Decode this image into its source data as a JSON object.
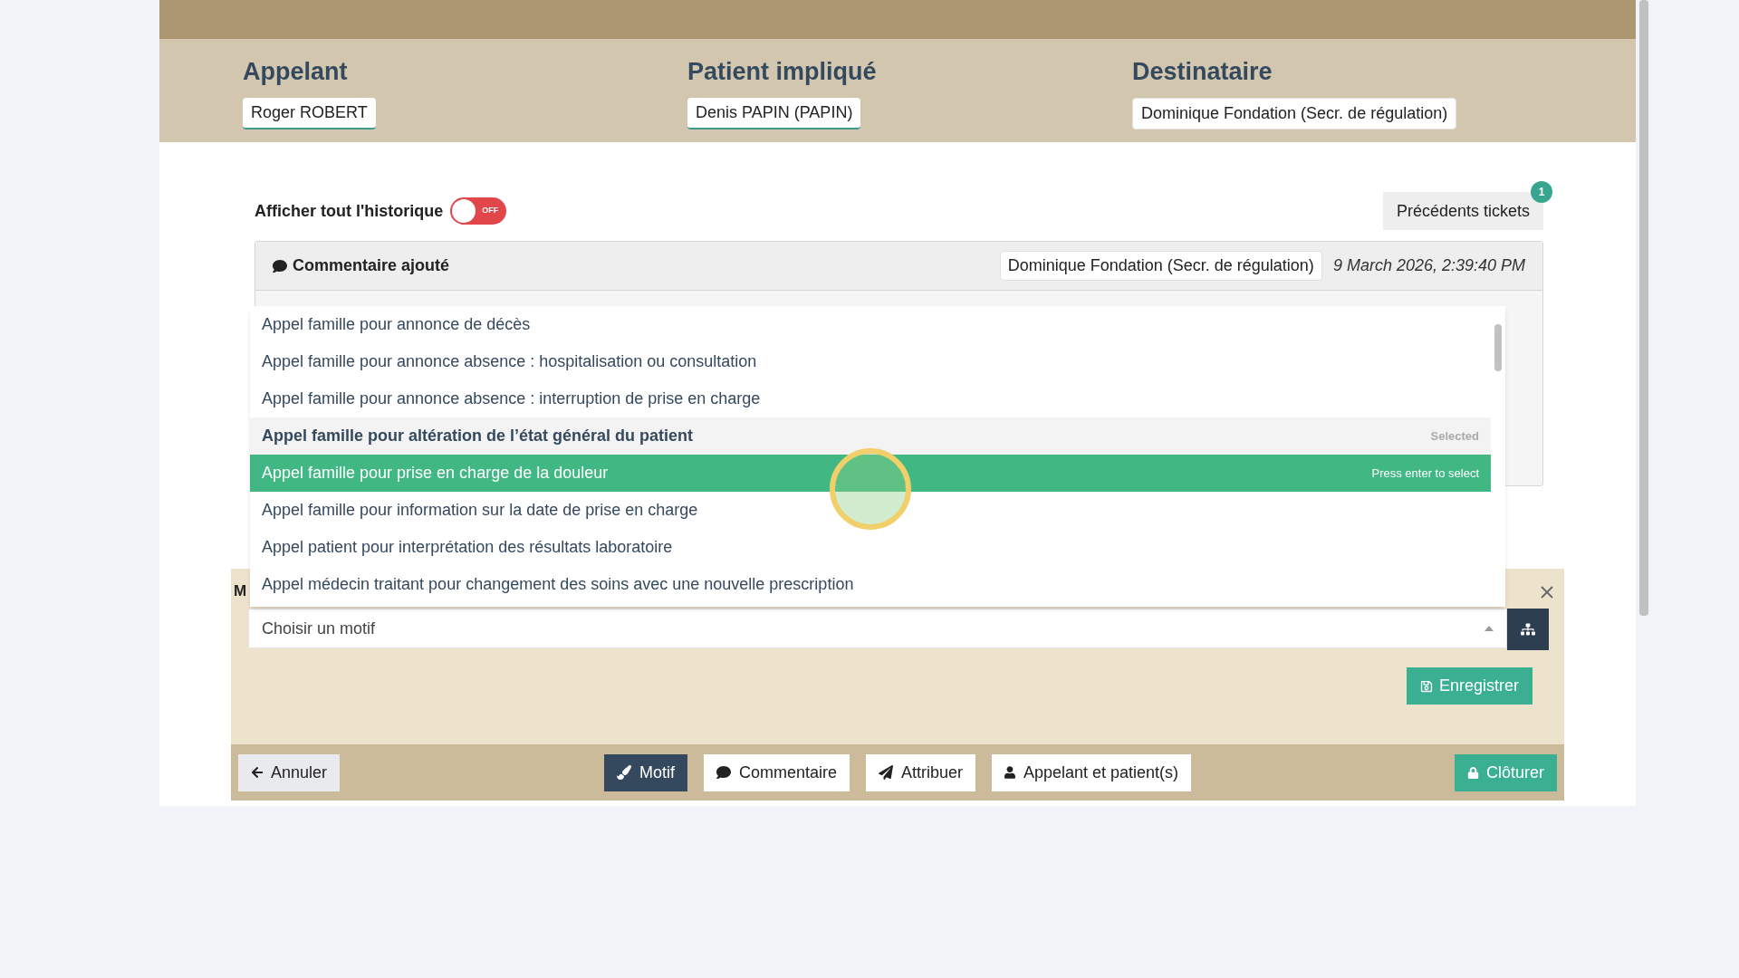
{
  "parties": [
    {
      "label": "Appelant",
      "value": "Roger ROBERT",
      "underlined": true
    },
    {
      "label": "Patient impliqué",
      "value": "Denis PAPIN (PAPIN)",
      "underlined": true
    },
    {
      "label": "Destinataire",
      "value": "Dominique Fondation (Secr. de régulation)",
      "underlined": false
    }
  ],
  "history": {
    "toggle_label": "Afficher tout l'historique",
    "on": false,
    "toggle_text": "OFF",
    "previous_tickets": "Précédents tickets",
    "previous_count": "1"
  },
  "entry": {
    "title": "Commentaire ajouté",
    "author": "Dominique Fondation (Secr. de régulation)",
    "date": "9 March 2026, 2:39:40 PM"
  },
  "motif_panel": {
    "title": "M",
    "placeholder": "Choisir un motif",
    "save": "Enregistrer"
  },
  "dropdown": {
    "options": [
      {
        "label": "Appel famille pour annonce de décès",
        "selected": false,
        "highlighted": false
      },
      {
        "label": "Appel famille pour annonce absence : hospitalisation ou consultation",
        "selected": false,
        "highlighted": false
      },
      {
        "label": "Appel famille pour annonce absence : interruption de prise en charge",
        "selected": false,
        "highlighted": false
      },
      {
        "label": "Appel famille pour altération de l’état général du patient",
        "selected": true,
        "highlighted": false,
        "hint": "Selected"
      },
      {
        "label": "Appel famille pour prise en charge de la douleur",
        "selected": false,
        "highlighted": true,
        "hint": "Press enter to select"
      },
      {
        "label": "Appel famille pour information sur la date de prise en charge",
        "selected": false,
        "highlighted": false
      },
      {
        "label": "Appel patient pour interprétation des résultats laboratoire",
        "selected": false,
        "highlighted": false
      },
      {
        "label": "Appel médecin traitant pour changement des soins avec une nouvelle prescription",
        "selected": false,
        "highlighted": false
      }
    ]
  },
  "footer": {
    "cancel": "Annuler",
    "actions": [
      {
        "kind": "motif",
        "label": "Motif",
        "selected": true
      },
      {
        "kind": "comment",
        "label": "Commentaire",
        "selected": false
      },
      {
        "kind": "assign",
        "label": "Attribuer",
        "selected": false
      },
      {
        "kind": "people",
        "label": "Appelant et patient(s)",
        "selected": false
      }
    ],
    "close": "Clôturer"
  }
}
